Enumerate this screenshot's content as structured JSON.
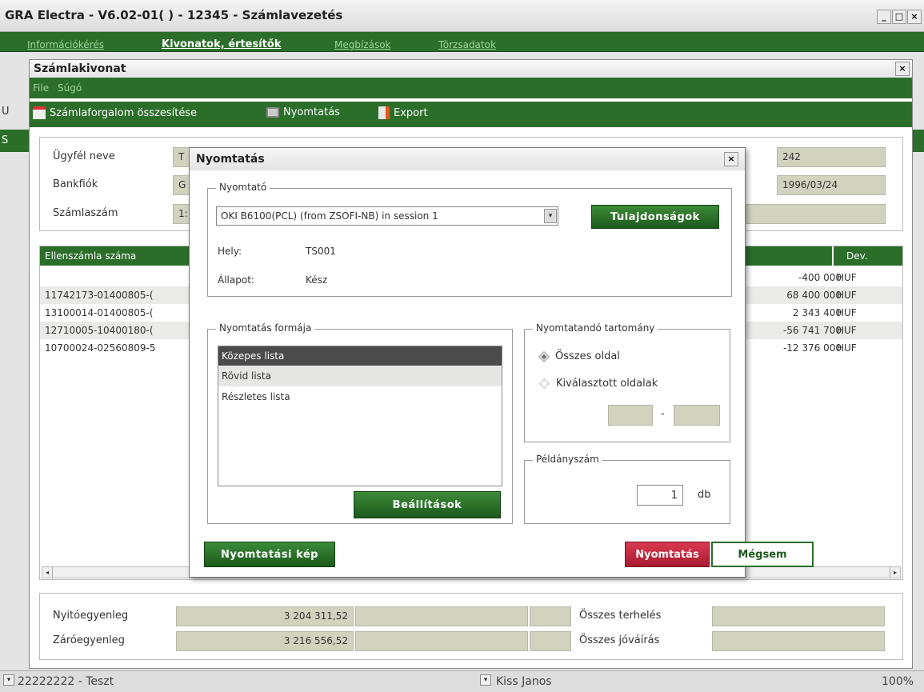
{
  "app": {
    "title": "GRA Electra - V6.02-01( ) - 12345 - Számlavezetés",
    "menu": [
      "Információkérés",
      "Kivonatok, értesítők",
      "Megbízások",
      "Törzsadatok"
    ],
    "side_letters": [
      "U",
      "S"
    ]
  },
  "statement": {
    "title": "Számlakivonat",
    "menu": [
      "File",
      "Súgó"
    ],
    "toolbar": {
      "summary": "Számlaforgalom összesítése",
      "print": "Nyomtatás",
      "export": "Export"
    },
    "fields": {
      "client_label": "Ügyfél neve",
      "client_value": "T",
      "branch_label": "Bankfiók",
      "branch_value": "G",
      "account_label": "Számlaszám",
      "account_value": "1:",
      "right_value_1": "242",
      "right_value_2": "1996/03/24",
      "right_value_3": ""
    },
    "table": {
      "col_counter": "Ellenszámla száma",
      "col_currency": "Dev.",
      "rows": [
        {
          "account": "",
          "amount": "-400 000",
          "currency": "HUF"
        },
        {
          "account": "11742173-01400805-(",
          "amount": "68 400 000",
          "currency": "HUF"
        },
        {
          "account": "13100014-01400805-(",
          "amount": "2 343 400",
          "currency": "HUF"
        },
        {
          "account": "12710005-10400180-(",
          "amount": "-56 741 700",
          "currency": "HUF"
        },
        {
          "account": "10700024-02560809-5",
          "amount": "-12 376 000",
          "currency": "HUF"
        }
      ]
    },
    "balances": {
      "opening_label": "Nyitóegyenleg",
      "opening_value": "3 204 311,52",
      "closing_label": "Záróegyenleg",
      "closing_value": "3 216 556,52",
      "total_debit_label": "Összes terhelés",
      "total_credit_label": "Összes jóváírás"
    }
  },
  "status": {
    "client": "22222222 - Teszt",
    "user": "Kiss Janos",
    "zoom": "100%"
  },
  "dialog": {
    "title": "Nyomtatás",
    "printer_group": "Nyomtató",
    "printer_selected": "OKI B6100(PCL) (from ZSOFI-NB) in session 1",
    "properties_button": "Tulajdonságok",
    "location_label": "Hely:",
    "location_value": "TS001",
    "state_label": "Állapot:",
    "state_value": "Kész",
    "form_group": "Nyomtatás formája",
    "form_options": [
      "Közepes lista",
      "Rövid lista",
      "Részletes lista"
    ],
    "settings_button": "Beállítások",
    "range_group": "Nyomtatandó tartomány",
    "range_all": "Összes oldal",
    "range_selected": "Kiválasztott oldalak",
    "range_from": "",
    "range_sep": "-",
    "range_to": "",
    "copies_group": "Példányszám",
    "copies_value": "1",
    "copies_unit": "db",
    "preview_button": "Nyomtatási kép",
    "print_button": "Nyomtatás",
    "cancel_button": "Mégsem"
  },
  "colors": {
    "brand_green": "#2b6e2a",
    "print_red": "#c0243c",
    "field_bg": "#d2d3bf"
  }
}
